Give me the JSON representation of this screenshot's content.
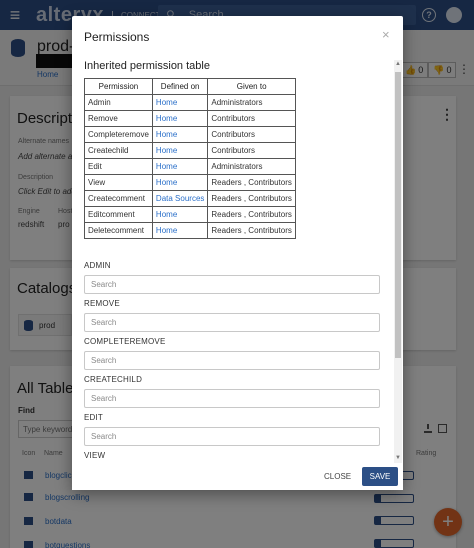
{
  "topbar": {
    "menu_glyph": "≡",
    "brand": "alteryx",
    "brand_sub": "CONNECT",
    "search_placeholder": "Search",
    "help_glyph": "?"
  },
  "header": {
    "title": "prod-c",
    "breadcrumb_home": "Home",
    "upvote_count": "0",
    "downvote_count": "0"
  },
  "description_card": {
    "title": "Description",
    "alternate_names_label": "Alternate names",
    "alternate_names_value": "Add alternate a",
    "description_label": "Description",
    "description_value": "Click Edit to add",
    "engine_label": "Engine",
    "engine_value": "redshift",
    "host_label": "Host",
    "host_value": "pro"
  },
  "catalogs_card": {
    "title": "Catalogs",
    "chip_label": "prod"
  },
  "tables_card": {
    "title": "All Tables",
    "find_label": "Find",
    "find_placeholder": "Type keyword",
    "col_icon": "Icon",
    "col_name": "Name",
    "col_rating": "Rating",
    "rows": [
      {
        "name": "blogclic",
        "rating": 0.15
      },
      {
        "name": "blogscrolling",
        "rating": 0.15
      },
      {
        "name": "botdata",
        "rating": 0.15
      },
      {
        "name": "botquestions",
        "rating": 0.15
      }
    ]
  },
  "modal": {
    "title": "Permissions",
    "close_glyph": "×",
    "inherited_heading": "Inherited permission table",
    "table_headers": [
      "Permission",
      "Defined on",
      "Given to"
    ],
    "table_rows": [
      {
        "permission": "Admin",
        "defined_on": "Home",
        "given_to": "Administrators"
      },
      {
        "permission": "Remove",
        "defined_on": "Home",
        "given_to": "Contributors"
      },
      {
        "permission": "Completeremove",
        "defined_on": "Home",
        "given_to": "Contributors"
      },
      {
        "permission": "Createchild",
        "defined_on": "Home",
        "given_to": "Contributors"
      },
      {
        "permission": "Edit",
        "defined_on": "Home",
        "given_to": "Administrators"
      },
      {
        "permission": "View",
        "defined_on": "Home",
        "given_to": "Readers , Contributors"
      },
      {
        "permission": "Createcomment",
        "defined_on": "Data Sources",
        "given_to": "Readers , Contributors"
      },
      {
        "permission": "Editcomment",
        "defined_on": "Home",
        "given_to": "Readers , Contributors"
      },
      {
        "permission": "Deletecomment",
        "defined_on": "Home",
        "given_to": "Readers , Contributors"
      }
    ],
    "sections": [
      {
        "label": "ADMIN",
        "placeholder": "Search"
      },
      {
        "label": "REMOVE",
        "placeholder": "Search"
      },
      {
        "label": "COMPLETEREMOVE",
        "placeholder": "Search"
      },
      {
        "label": "CREATECHILD",
        "placeholder": "Search"
      },
      {
        "label": "EDIT",
        "placeholder": "Search"
      },
      {
        "label": "VIEW",
        "placeholder": "Search"
      }
    ],
    "close_label": "CLOSE",
    "save_label": "SAVE"
  },
  "colors": {
    "primary": "#2c4f86",
    "link": "#2a6fc9",
    "fab": "#e5672a"
  }
}
